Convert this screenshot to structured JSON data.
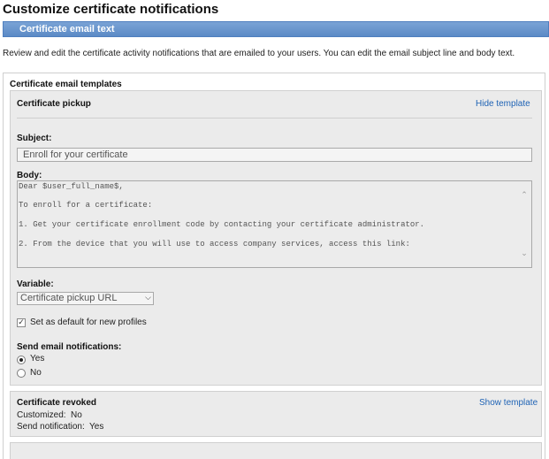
{
  "page": {
    "title": "Customize certificate notifications",
    "section_bar": "Certificate email text",
    "intro": "Review and edit the certificate activity notifications that are emailed to your users. You can edit the email subject line and body text."
  },
  "templates": {
    "heading": "Certificate email templates",
    "pickup": {
      "title": "Certificate pickup",
      "toggle_link": "Hide template",
      "subject_label": "Subject:",
      "subject_value": "Enroll for your certificate",
      "body_label": "Body:",
      "body_lines": [
        "Dear $user_full_name$,",
        "To enroll for a certificate:",
        "1. Get your certificate enrollment code by contacting your certificate administrator.",
        "2. From the device that you will use to access company services, access this link:"
      ],
      "variable_label": "Variable:",
      "variable_value": "Certificate pickup URL",
      "default_checkbox_label": "Set as default for new profiles",
      "default_checked": true,
      "send_label": "Send email notifications:",
      "send_yes": "Yes",
      "send_no": "No",
      "send_selected": "Yes"
    },
    "revoked": {
      "title": "Certificate revoked",
      "toggle_link": "Show template",
      "customized_label": "Customized:",
      "customized_value": "No",
      "send_notification_label": "Send notification:",
      "send_notification_value": "Yes"
    }
  },
  "colors": {
    "section_bar": "#5b8ac6",
    "link": "#1f63b5",
    "card_bg": "#ebebeb"
  },
  "icons": {
    "scroll_up": "chevron-up-icon",
    "scroll_down": "chevron-down-icon",
    "select_chevron": "chevron-down-icon",
    "checkbox_mark": "checkmark-icon"
  }
}
